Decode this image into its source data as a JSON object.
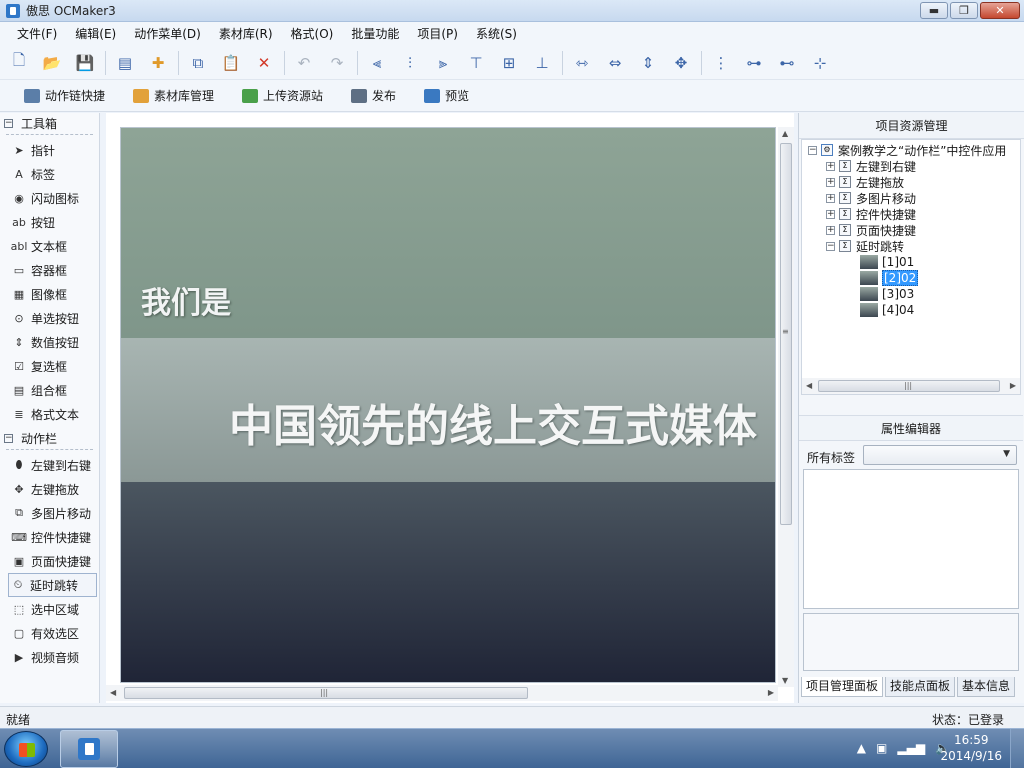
{
  "window": {
    "title": "傲思 OCMaker3",
    "btn_min": "▬",
    "btn_max": "❐",
    "btn_close": "✕"
  },
  "menubar": {
    "items": [
      "文件(F)",
      "编辑(E)",
      "动作菜单(D)",
      "素材库(R)",
      "格式(O)",
      "批量功能",
      "项目(P)",
      "系统(S)"
    ]
  },
  "toolbar1": {
    "icons": [
      "new-file-icon",
      "open-folder-icon",
      "save-icon",
      "properties-icon",
      "plugin-icon",
      "copy-icon",
      "paste-icon",
      "delete-icon",
      "undo-icon",
      "redo-icon",
      "align-left-icon",
      "align-center-icon",
      "align-right-icon",
      "align-top-icon",
      "align-middle-icon",
      "align-bottom-icon",
      "distribute-h-icon",
      "same-width-icon",
      "same-height-icon",
      "same-size-icon",
      "distribute-v-icon",
      "space-h-icon",
      "space-v-icon",
      "center-icon"
    ]
  },
  "toolbar2": {
    "items": [
      {
        "label": "动作链快捷",
        "icon": "action-chain-icon",
        "color": "#5b7ea8"
      },
      {
        "label": "素材库管理",
        "icon": "library-icon",
        "color": "#e2a13a"
      },
      {
        "label": "上传资源站",
        "icon": "upload-icon",
        "color": "#4aa04a"
      },
      {
        "label": "发布",
        "icon": "publish-icon",
        "color": "#5e6f84"
      },
      {
        "label": "预览",
        "icon": "preview-icon",
        "color": "#3a79c1"
      }
    ]
  },
  "toolbox": {
    "section1": {
      "label": "工具箱",
      "toggle": "−"
    },
    "tools": [
      {
        "label": "指针",
        "glyph": "➤"
      },
      {
        "label": "标签",
        "glyph": "A"
      },
      {
        "label": "闪动图标",
        "glyph": "◉"
      },
      {
        "label": "按钮",
        "glyph": "ab"
      },
      {
        "label": "文本框",
        "glyph": "abl"
      },
      {
        "label": "容器框",
        "glyph": "▭"
      },
      {
        "label": "图像框",
        "glyph": "▦"
      },
      {
        "label": "单选按钮",
        "glyph": "⊙"
      },
      {
        "label": "数值按钮",
        "glyph": "⇕"
      },
      {
        "label": "复选框",
        "glyph": "☑"
      },
      {
        "label": "组合框",
        "glyph": "▤"
      },
      {
        "label": "格式文本",
        "glyph": "≣"
      }
    ],
    "section2": {
      "label": "动作栏",
      "toggle": "−"
    },
    "actions": [
      {
        "label": "左键到右键",
        "glyph": "⬮"
      },
      {
        "label": "左键拖放",
        "glyph": "✥"
      },
      {
        "label": "多图片移动",
        "glyph": "⧉"
      },
      {
        "label": "控件快捷键",
        "glyph": "⌨"
      },
      {
        "label": "页面快捷键",
        "glyph": "▣"
      },
      {
        "label": "延时跳转",
        "glyph": "⏲"
      },
      {
        "label": "选中区域",
        "glyph": "⬚"
      },
      {
        "label": "有效选区",
        "glyph": "▢"
      },
      {
        "label": "视频音频",
        "glyph": "▶"
      }
    ],
    "selected_action": "延时跳转"
  },
  "canvas": {
    "line1": "我们是",
    "line2": "中国领先的线上交互式媒体"
  },
  "project_panel": {
    "title": "项目资源管理",
    "root": "案例教学之“动作栏”中控件应用",
    "children": [
      "左键到右键",
      "左键拖放",
      "多图片移动",
      "控件快捷键",
      "页面快捷键",
      "延时跳转"
    ],
    "pages": [
      "[1]01",
      "[2]02",
      "[3]03",
      "[4]04"
    ],
    "selected_page": "[2]02"
  },
  "property_panel": {
    "title": "属性编辑器",
    "label": "所有标签",
    "select_value": ""
  },
  "panel_tabs": [
    "项目管理面板",
    "技能点面板",
    "基本信息"
  ],
  "statusbar": {
    "left": "就绪",
    "right": "状态：已登录"
  },
  "taskbar": {
    "time": "16:59",
    "date": "2014/9/16"
  }
}
